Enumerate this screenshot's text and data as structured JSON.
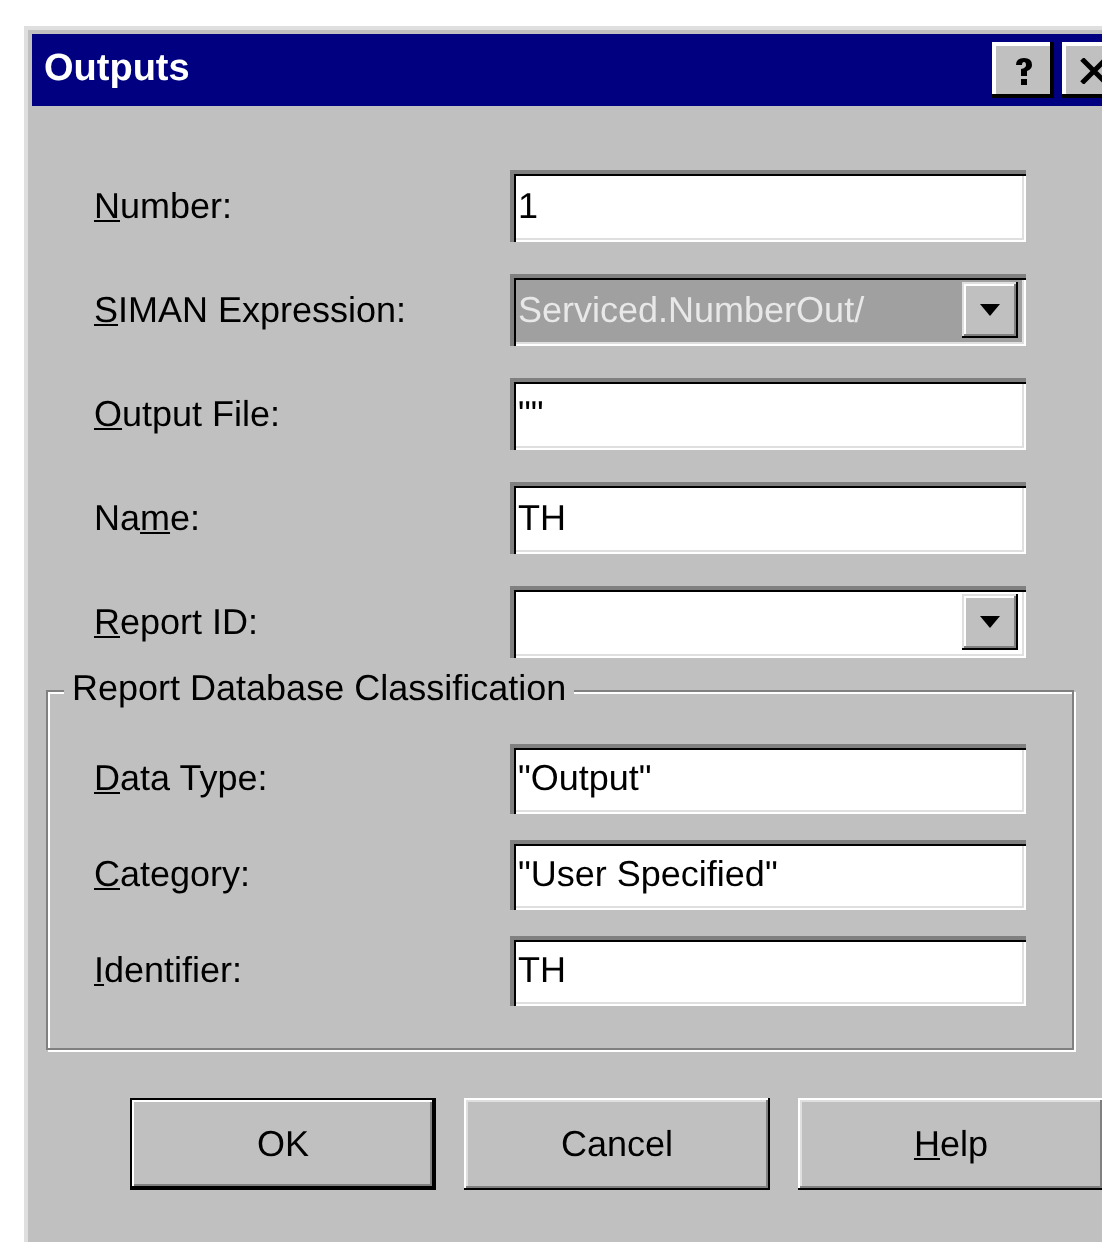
{
  "window": {
    "title": "Outputs"
  },
  "fields": [
    {
      "kind": "text",
      "label": {
        "key": "N",
        "post": "umber:"
      },
      "value": "1",
      "disabled": false
    },
    {
      "kind": "dropdown",
      "label": {
        "key": "S",
        "post": "IMAN Expression:"
      },
      "value": "Serviced.NumberOut/",
      "disabled": true
    },
    {
      "kind": "text",
      "label": {
        "key": "O",
        "post": "utput File:"
      },
      "value": "\"\"",
      "disabled": false
    },
    {
      "kind": "text",
      "label": {
        "pre": "Na",
        "key": "m",
        "post": "e:"
      },
      "value": "TH",
      "disabled": false
    },
    {
      "kind": "dropdown",
      "label": {
        "key": "R",
        "post": "eport ID:"
      },
      "disabled": false
    }
  ],
  "group": {
    "title": "Report Database Classification",
    "fields": [
      {
        "kind": "text",
        "label": {
          "key": "D",
          "post": "ata Type:"
        },
        "value": "\"Output\"",
        "disabled": false
      },
      {
        "kind": "text",
        "label": {
          "key": "C",
          "post": "ategory:"
        },
        "value": "\"User Specified\"",
        "disabled": false
      },
      {
        "kind": "text",
        "label": {
          "key": "I",
          "post": "dentifier:"
        },
        "value": "TH",
        "disabled": false
      }
    ]
  },
  "buttons": [
    {
      "label": {
        "post": "OK"
      },
      "default": true
    },
    {
      "label": {
        "post": "Cancel"
      },
      "default": false
    },
    {
      "label": {
        "key": "H",
        "post": "elp"
      },
      "default": false
    }
  ]
}
